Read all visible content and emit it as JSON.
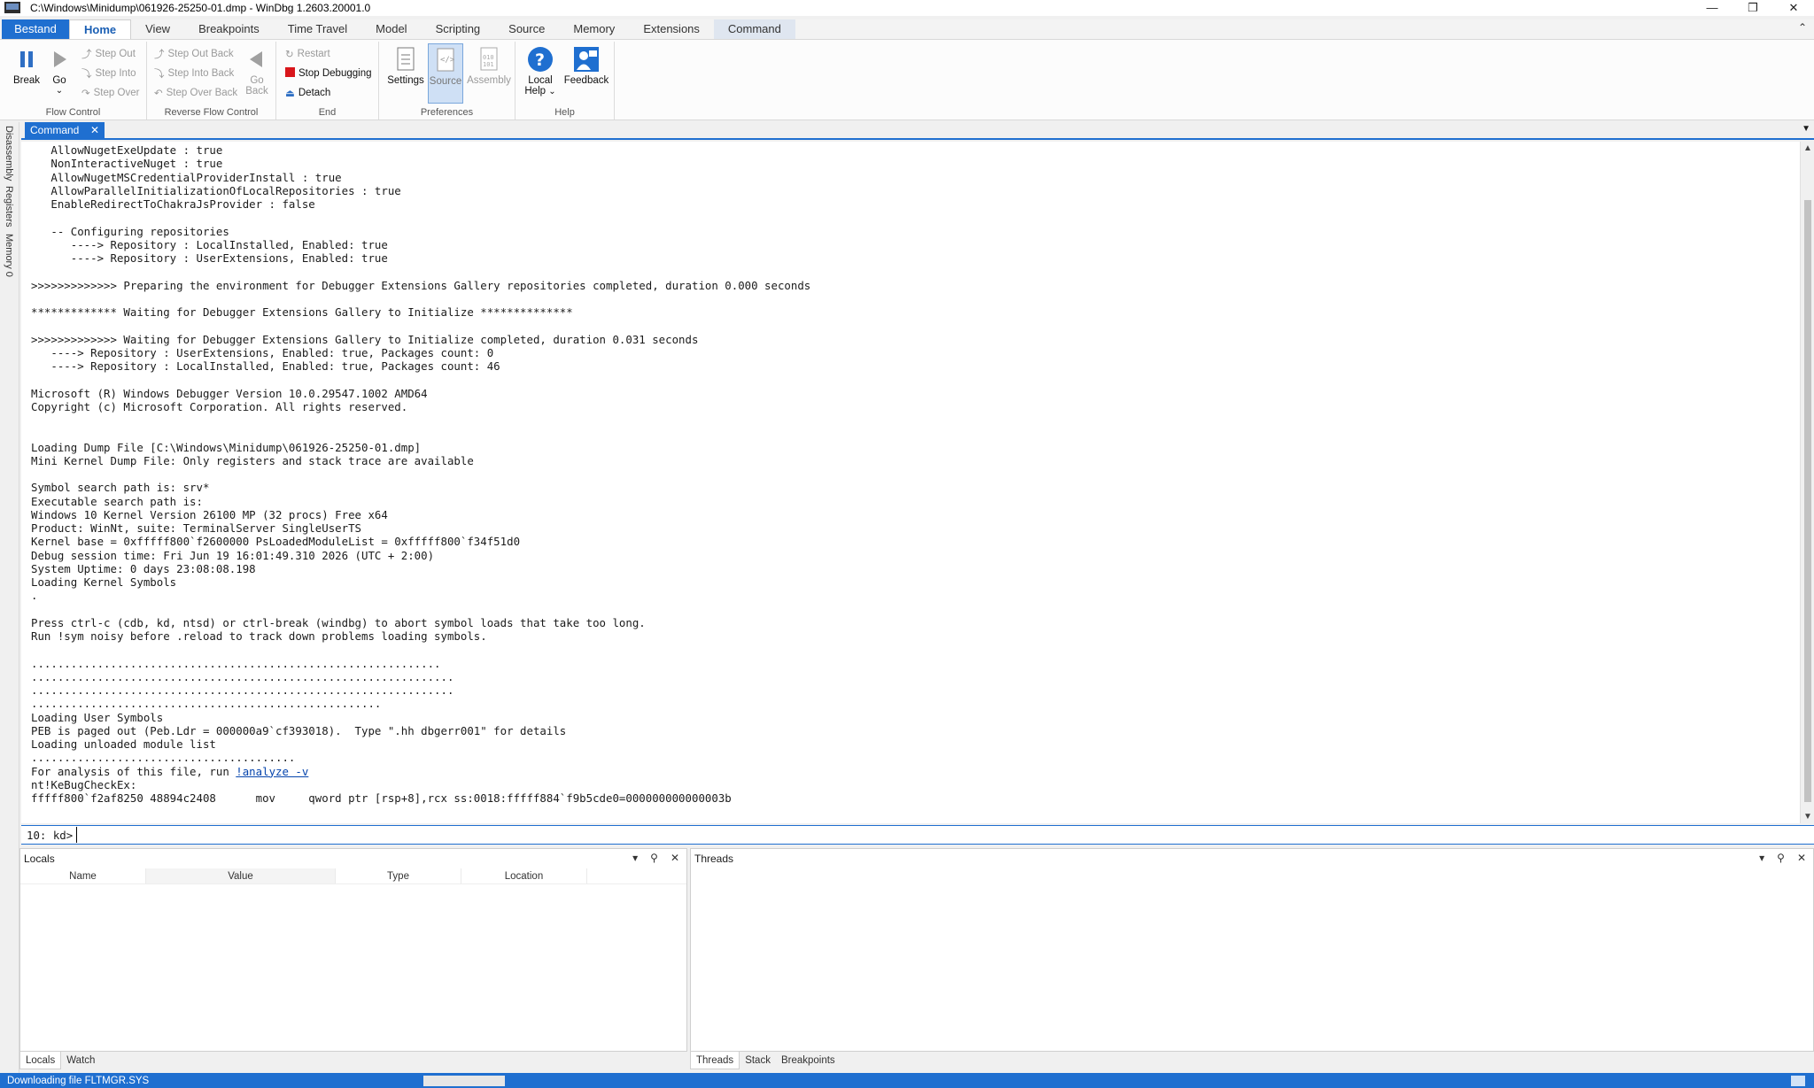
{
  "window": {
    "title": "C:\\Windows\\Minidump\\061926-25250-01.dmp - WinDbg 1.2603.20001.0",
    "controls": [
      "—",
      "❐",
      "✕"
    ]
  },
  "ribbon_tabs": [
    "Bestand",
    "Home",
    "View",
    "Breakpoints",
    "Time Travel",
    "Model",
    "Scripting",
    "Source",
    "Memory",
    "Extensions",
    "Command"
  ],
  "ribbon": {
    "flow_control": {
      "label": "Flow Control",
      "break": "Break",
      "go": "Go",
      "step_out": "Step Out",
      "step_into": "Step Into",
      "step_over": "Step Over"
    },
    "reverse_flow": {
      "label": "Reverse Flow Control",
      "step_out_back": "Step Out Back",
      "step_into_back": "Step Into Back",
      "step_over_back": "Step Over Back",
      "go_back_1": "Go",
      "go_back_2": "Back"
    },
    "end": {
      "label": "End",
      "restart": "Restart",
      "stop": "Stop Debugging",
      "detach": "Detach"
    },
    "preferences": {
      "label": "Preferences",
      "settings": "Settings",
      "source": "Source",
      "assembly": "Assembly"
    },
    "help": {
      "label": "Help",
      "local_help_1": "Local",
      "local_help_2": "Help",
      "feedback": "Feedback"
    }
  },
  "side_tabs": [
    "Disassembly",
    "Registers",
    "Memory 0"
  ],
  "command_tab": {
    "label": "Command"
  },
  "command_output": [
    "   AllowNugetExeUpdate : true",
    "   NonInteractiveNuget : true",
    "   AllowNugetMSCredentialProviderInstall : true",
    "   AllowParallelInitializationOfLocalRepositories : true",
    "   EnableRedirectToChakraJsProvider : false",
    "",
    "   -- Configuring repositories",
    "      ----> Repository : LocalInstalled, Enabled: true",
    "      ----> Repository : UserExtensions, Enabled: true",
    "",
    ">>>>>>>>>>>>> Preparing the environment for Debugger Extensions Gallery repositories completed, duration 0.000 seconds",
    "",
    "************* Waiting for Debugger Extensions Gallery to Initialize **************",
    "",
    ">>>>>>>>>>>>> Waiting for Debugger Extensions Gallery to Initialize completed, duration 0.031 seconds",
    "   ----> Repository : UserExtensions, Enabled: true, Packages count: 0",
    "   ----> Repository : LocalInstalled, Enabled: true, Packages count: 46",
    "",
    "Microsoft (R) Windows Debugger Version 10.0.29547.1002 AMD64",
    "Copyright (c) Microsoft Corporation. All rights reserved.",
    "",
    "",
    "Loading Dump File [C:\\Windows\\Minidump\\061926-25250-01.dmp]",
    "Mini Kernel Dump File: Only registers and stack trace are available",
    "",
    "Symbol search path is: srv*",
    "Executable search path is:",
    "Windows 10 Kernel Version 26100 MP (32 procs) Free x64",
    "Product: WinNt, suite: TerminalServer SingleUserTS",
    "Kernel base = 0xfffff800`f2600000 PsLoadedModuleList = 0xfffff800`f34f51d0",
    "Debug session time: Fri Jun 19 16:01:49.310 2026 (UTC + 2:00)",
    "System Uptime: 0 days 23:08:08.198",
    "Loading Kernel Symbols",
    ".",
    "",
    "Press ctrl-c (cdb, kd, ntsd) or ctrl-break (windbg) to abort symbol loads that take too long.",
    "Run !sym noisy before .reload to track down problems loading symbols.",
    "",
    "..............................................................",
    "................................................................",
    "................................................................",
    ".....................................................",
    "Loading User Symbols",
    "PEB is paged out (Peb.Ldr = 000000a9`cf393018).  Type \".hh dbgerr001\" for details",
    "Loading unloaded module list",
    "........................................"
  ],
  "analyze_prefix": "For analysis of this file, run ",
  "analyze_link": "!analyze -v",
  "output_tail": [
    "nt!KeBugCheckEx:",
    "fffff800`f2af8250 48894c2408      mov     qword ptr [rsp+8],rcx ss:0018:fffff884`f9b5cde0=000000000000003b"
  ],
  "prompt": {
    "label": "10: kd>",
    "value": ""
  },
  "locals_pane": {
    "title": "Locals",
    "columns": [
      "Name",
      "Value",
      "Type",
      "Location"
    ],
    "tabs": [
      "Locals",
      "Watch"
    ]
  },
  "threads_pane": {
    "title": "Threads",
    "tabs": [
      "Threads",
      "Stack",
      "Breakpoints"
    ]
  },
  "status": {
    "text": "Downloading file FLTMGR.SYS",
    "progress": 1.0
  },
  "colors": {
    "accent": "#1f6fd0",
    "progress": "#06b025"
  }
}
